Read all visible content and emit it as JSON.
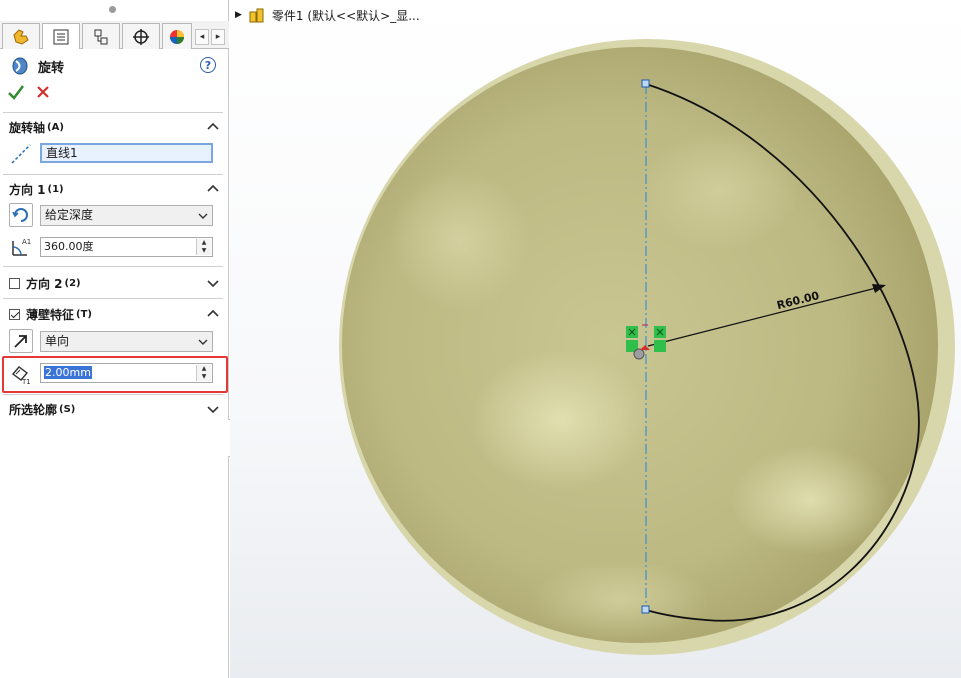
{
  "panel": {
    "feature_title": "旋转",
    "axis_section": {
      "title": "旋转轴",
      "suffix": "(A)",
      "value": "直线1"
    },
    "direction1": {
      "title": "方向 1",
      "suffix": "(1)",
      "end_condition": "给定深度",
      "angle": "360.00度"
    },
    "direction2": {
      "title": "方向 2",
      "suffix": "(2)",
      "checked": false
    },
    "thin_feature": {
      "title": "薄壁特征",
      "suffix": "(T)",
      "checked": true,
      "type": "单向",
      "thickness": "2.00mm"
    },
    "selected_contours": {
      "title": "所选轮廓",
      "suffix": "(S)"
    }
  },
  "tree": {
    "label": "零件1 (默认<<默认>_显..."
  },
  "sketch": {
    "dimension_label": "R60.00"
  },
  "colors": {
    "sphere": "#c7c48f",
    "sphere_rim": "#dcdbb2",
    "highlight": "#e53935",
    "axis": "#3a8fd6"
  }
}
